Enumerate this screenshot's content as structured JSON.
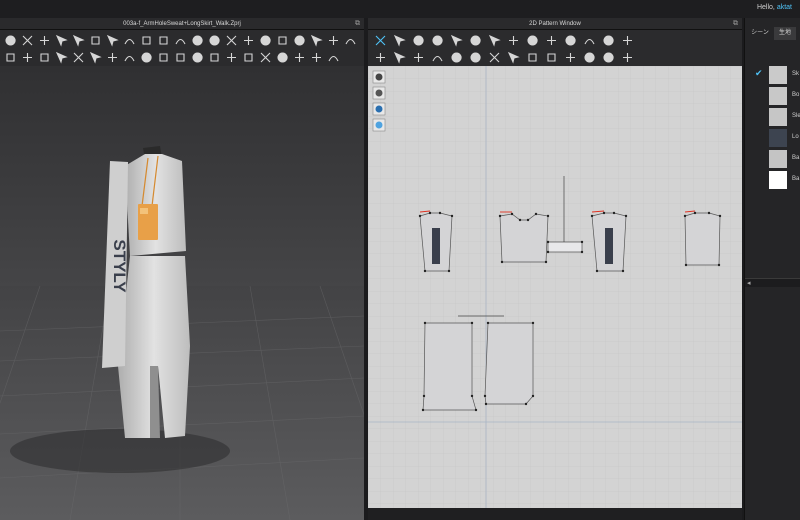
{
  "header": {
    "greeting": "Hello,",
    "username": "aktat"
  },
  "panels": {
    "view3d_title": "003a-f_ArmHoleSweat+LongSkirt_Walk.Zprj",
    "view2d_title": "2D Pattern Window",
    "expand_glyph": "⧉"
  },
  "right_panel": {
    "tabs": [
      "シーン",
      "生地"
    ],
    "fabrics": [
      {
        "name": "Sk",
        "checked": true,
        "color": "#cacaca"
      },
      {
        "name": "Bo",
        "checked": false,
        "color": "#c8c8c8"
      },
      {
        "name": "Sle",
        "checked": false,
        "color": "#c6c6c6"
      },
      {
        "name": "Lo",
        "checked": false,
        "color": "#3d4450"
      },
      {
        "name": "Ba",
        "checked": false,
        "color": "#c4c4c4"
      },
      {
        "name": "Ba",
        "checked": false,
        "color": "#ffffff"
      }
    ],
    "check_glyph": "✔",
    "collapse_glyph": "◂"
  },
  "garment": {
    "sleeve_text": "STYLY",
    "bag_color": "#e8a048"
  },
  "colors": {
    "accent": "#4fc3f7",
    "icon": "#d6d6d6",
    "pattern_fill": "#d4d4d6",
    "pattern_point": "#222222",
    "pattern_accent": "#e03020",
    "grid_line": "#c4c4c4",
    "axis_line": "#a9b4c4"
  },
  "icons": {
    "toolbar3d": [
      "select-icon",
      "move-icon",
      "rotate-icon",
      "fold-icon",
      "pin-icon",
      "tack-icon",
      "segment-icon",
      "sew-icon",
      "arrange-icon",
      "avatar-icon",
      "fabric-icon",
      "texture-icon",
      "button-icon",
      "buttonhole-icon",
      "zipper-icon",
      "topstitch-icon",
      "pleat-icon",
      "measure-icon",
      "grading-icon",
      "fitting-icon",
      "pressure-icon",
      "shrink-icon",
      "edit-icon",
      "trim-icon",
      "graphic-icon",
      "line-icon",
      "curve-icon",
      "strap-icon",
      "piping-icon",
      "elastic-icon",
      "puckering-icon",
      "solidify-icon",
      "deactivate-icon",
      "freeze-icon",
      "hide-icon",
      "show-icon",
      "layer-icon",
      "reset-icon",
      "camera-icon",
      "light-icon",
      "render-icon"
    ],
    "toolbar2d": [
      "transform-pattern-icon",
      "edit-pattern-icon",
      "edit-curve-icon",
      "add-point-icon",
      "rectangle-icon",
      "polygon-icon",
      "ellipse-icon",
      "internal-line-icon",
      "dart-icon",
      "segment-sew-icon",
      "free-sew-icon",
      "notch-icon",
      "fold-arrange-icon",
      "tack-2d-icon",
      "unfold-icon",
      "texture-2d-icon",
      "graphic-2d-icon",
      "trace-icon",
      "mirror-icon",
      "grain-icon",
      "symmetric-icon",
      "measure-2d-icon",
      "ruler-icon",
      "annotation-icon",
      "baseline-icon",
      "align-icon",
      "distribute-icon",
      "group-icon"
    ],
    "side2d": [
      "pen-icon",
      "brush-icon",
      "info-icon",
      "layers-icon"
    ]
  }
}
